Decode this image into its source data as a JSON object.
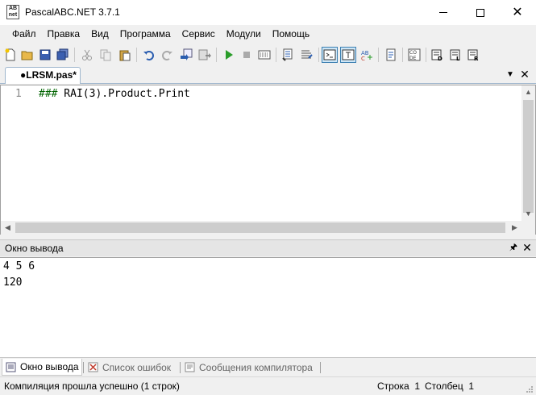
{
  "window": {
    "title": "PascalABC.NET 3.7.1",
    "icon_text_top": "AB",
    "icon_text_bottom": "net"
  },
  "menu": {
    "items": [
      "Файл",
      "Правка",
      "Вид",
      "Программа",
      "Сервис",
      "Модули",
      "Помощь"
    ]
  },
  "toolbar": {
    "icons": [
      "new-file-icon",
      "open-folder-icon",
      "save-icon",
      "save-all-icon",
      "cut-icon",
      "copy-icon",
      "paste-icon",
      "undo-icon",
      "redo-icon",
      "compile-icon",
      "build-icon",
      "run-icon",
      "stop-icon",
      "debug-icon",
      "comment-icon",
      "uncomment-icon",
      "output-panel-icon",
      "text-icon",
      "spell-icon",
      "form-icon",
      "code-icon",
      "export-d-icon",
      "export-l-icon",
      "export-r-icon"
    ]
  },
  "editor": {
    "tab_label": "●LRSM.pas*",
    "line_number": "1",
    "code_prefix": "###",
    "code_body": " RAI(3).Product.Print"
  },
  "output_panel": {
    "title": "Окно вывода",
    "lines": [
      "4 5 6",
      "120"
    ]
  },
  "bottom_tabs": {
    "output": "Окно вывода",
    "errors": "Список ошибок",
    "compiler": "Сообщения компилятора"
  },
  "status": {
    "message": "Компиляция прошла успешно (1 строк)",
    "row_label": "Строка",
    "row_value": "1",
    "col_label": "Столбец",
    "col_value": "1"
  },
  "colors": {
    "accent": "#3c7fb1",
    "run_green": "#2a9d2a"
  }
}
